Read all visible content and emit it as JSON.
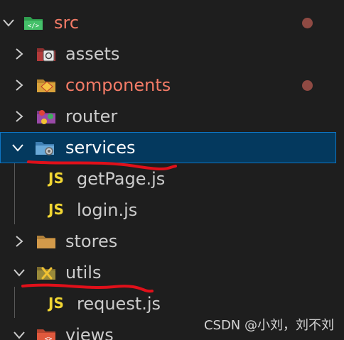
{
  "tree": {
    "src": {
      "label": "src",
      "modified": true
    },
    "assets": {
      "label": "assets"
    },
    "components": {
      "label": "components",
      "modified": true
    },
    "router": {
      "label": "router"
    },
    "services": {
      "label": "services",
      "selected": true
    },
    "getPage": {
      "label": "getPage.js",
      "badge": "JS"
    },
    "login": {
      "label": "login.js",
      "badge": "JS"
    },
    "stores": {
      "label": "stores"
    },
    "utils": {
      "label": "utils"
    },
    "request": {
      "label": "request.js",
      "badge": "JS"
    },
    "views": {
      "label": "views"
    }
  },
  "watermark": "CSDN @小刘，刘不刘",
  "colors": {
    "background": "#1e1e1e",
    "selected_bg": "#04395e",
    "selected_border": "#0e75c4",
    "modified_text": "#f47b67",
    "modified_dot": "#8f4a43",
    "js_badge": "#f1d633",
    "annotation": "#e0101a"
  }
}
